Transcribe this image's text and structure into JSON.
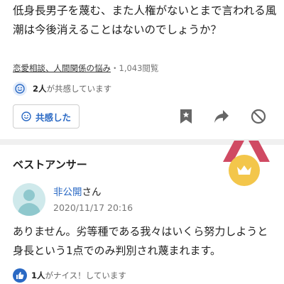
{
  "question": {
    "text": "低身長男子を蔑む、また人権がないとまで言われる風潮は今後消えることはないのでしょうか？"
  },
  "meta": {
    "categories": "恋愛相談、人間関係の悩み",
    "separator": "・",
    "views": "1,043閲覧"
  },
  "empathy": {
    "count": "2人",
    "suffix": "が共感しています"
  },
  "actions": {
    "empathy_button_label": "共感した",
    "icons": [
      "smile-icon",
      "bookmark-star-icon",
      "share-icon",
      "block-icon"
    ]
  },
  "best_answer": {
    "heading": "ベストアンサー",
    "medal_icon": "crown-medal-icon",
    "user_name": "非公開",
    "user_suffix": "さん",
    "date": "2020/11/17 20:16",
    "text": "ありません。劣等種である我々はいくら努力しようと身長という1点でのみ判別され蔑まれます。",
    "nice_count": "1人",
    "nice_suffix": "がナイス！しています"
  },
  "colors": {
    "accent_blue": "#2a69c4",
    "medal_gold": "#f3c64b",
    "ribbon_red": "#d04a63",
    "avatar_teal": "#8fc8cd",
    "divider_gray": "#f0f0f0"
  }
}
